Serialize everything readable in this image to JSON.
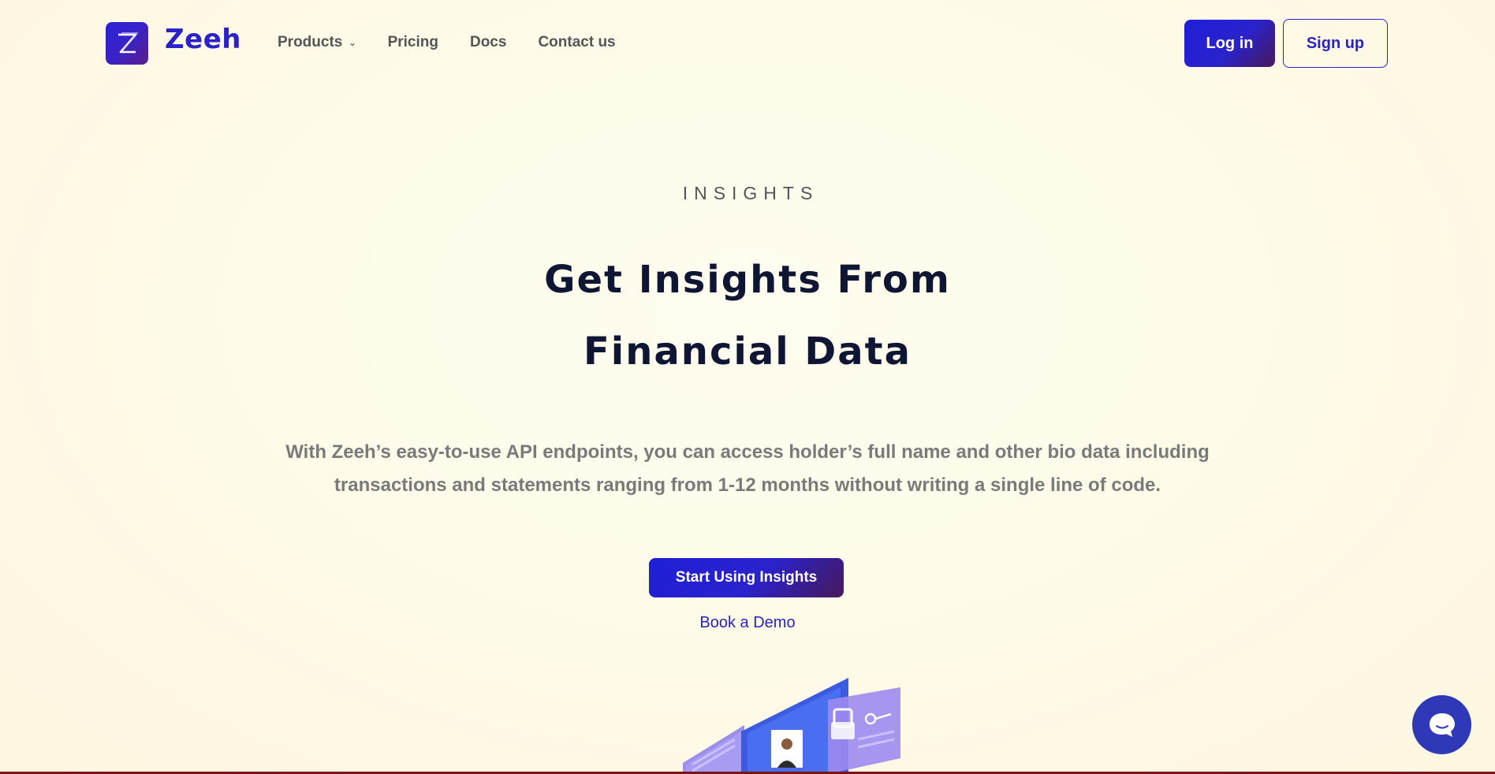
{
  "brand": {
    "name": "Zeeh",
    "logo_icon": "zeeh-z-logo-icon",
    "accent_color": "#2a22c7",
    "gradient_end": "#4a1a5a"
  },
  "nav": {
    "items": [
      {
        "label": "Products",
        "has_dropdown": true
      },
      {
        "label": "Pricing"
      },
      {
        "label": "Docs"
      },
      {
        "label": "Contact us"
      }
    ]
  },
  "auth": {
    "login_label": "Log in",
    "signup_label": "Sign up"
  },
  "hero": {
    "eyebrow": "INSIGHTS",
    "headline_line1": "Get Insights From",
    "headline_line2": "Financial Data",
    "subtext_line1": "With Zeeh’s easy-to-use API endpoints, you can access holder’s full name and other bio data including",
    "subtext_line2": "transactions and statements ranging from 1-12 months without writing a single line of code.",
    "cta_label": "Start Using Insights",
    "demo_label": "Book a Demo"
  },
  "chat": {
    "icon": "chat-bubble-icon"
  }
}
